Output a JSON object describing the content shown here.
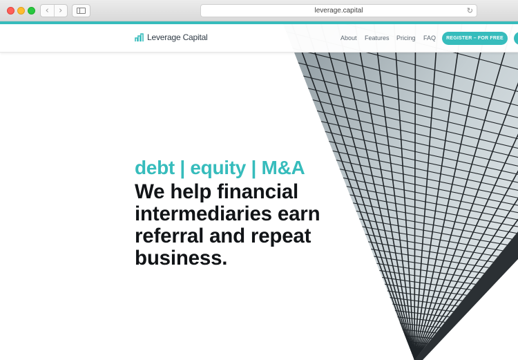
{
  "browser": {
    "url": "leverage.capital",
    "back_icon": "chevron-left-icon",
    "forward_icon": "chevron-right-icon",
    "sidebar_icon": "sidebar-icon",
    "reload_icon": "reload-icon"
  },
  "site": {
    "logo_text": "Leverage Capital",
    "nav": [
      "About",
      "Features",
      "Pricing",
      "FAQ"
    ],
    "cta": "REGISTER – FOR FREE",
    "accent_color": "#36bcbc"
  },
  "hero": {
    "tagline": "debt | equity | M&A",
    "headline": "We help financial intermediaries earn referral and repeat business."
  }
}
